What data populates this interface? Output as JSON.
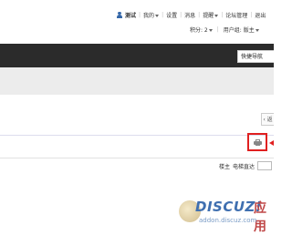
{
  "header": {
    "username": "测试",
    "nav": [
      "我的",
      "设置",
      "消息",
      "提醒",
      "论坛管理",
      "退出"
    ],
    "credits_label": "积分: 2",
    "user_group_label": "用户组: 版主"
  },
  "nav_bar": {
    "quick_nav_label": "快捷导航"
  },
  "side_button_label": "‹ 返",
  "thread_toolbar": {
    "print_icon": "printer-icon"
  },
  "filter": {
    "only_author_label": "楼主",
    "jump_label": "电梯直达"
  },
  "watermark": {
    "brand": "DISCUZ!",
    "suffix": "应用",
    "sub": "addon.discuz.com"
  },
  "colors": {
    "dark_bar": "#2b2b2b",
    "highlight": "#e02020",
    "accent": "#3f6fb0"
  }
}
